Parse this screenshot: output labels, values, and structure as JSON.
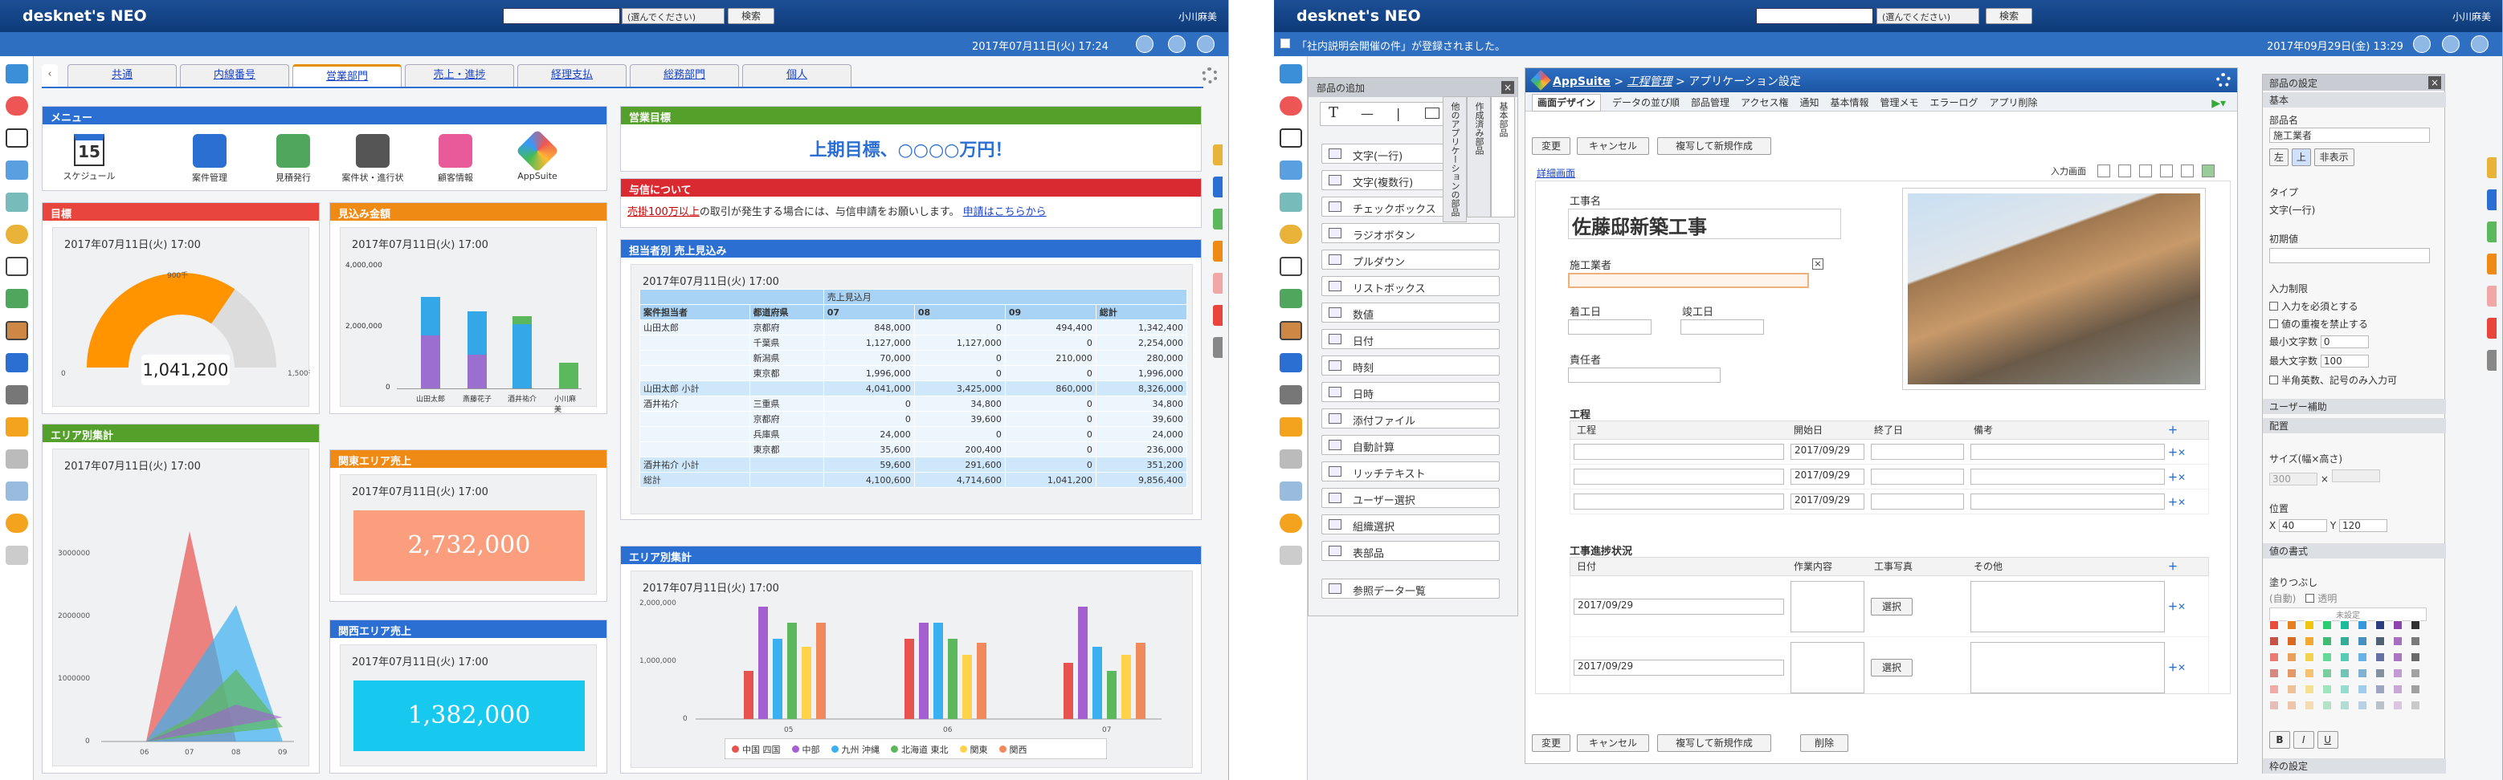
{
  "common": {
    "logo": "desknet's NEO",
    "select": "(選んでください)",
    "search": "検索",
    "user": "小川麻美"
  },
  "w1": {
    "date": "2017年07月11日(火) 17:24",
    "tabs": [
      "共通",
      "内線番号",
      "営業部門",
      "売上・進捗",
      "経理支払",
      "総務部門",
      "個人"
    ],
    "menu": {
      "title": "メニュー",
      "items": [
        "スケジュール",
        "案件管理",
        "見積発行",
        "案件状・進行状",
        "顧客情報",
        "AppSuite"
      ],
      "cal_day": "15"
    },
    "goal": {
      "title": "目標",
      "ts": "2017年07月11日(火) 17:00",
      "value": "1,041,200",
      "min": "0",
      "mid": "900千",
      "max": "1,500千",
      "fraction": 0.69
    },
    "mikomi": {
      "title": "見込み金額",
      "ts": "2017年07月11日(火) 17:00",
      "ylabels": [
        "4,000,000",
        "2,000,000",
        "0"
      ],
      "names": [
        "山田太郎",
        "斎藤花子",
        "酒井祐介",
        "小川麻美"
      ]
    },
    "area": {
      "title": "エリア別集計",
      "ts": "2017年07月11日(火) 17:00",
      "ylabels": [
        "3000000",
        "2000000",
        "1000000",
        "0"
      ],
      "x": [
        "06",
        "07",
        "08",
        "09"
      ]
    },
    "kanto": {
      "title": "関東エリア売上",
      "ts": "2017年07月11日(火) 17:00",
      "value": "2,732,000",
      "color": "#fb9e7d"
    },
    "kansai": {
      "title": "関西エリア売上",
      "ts": "2017年07月11日(火) 17:00",
      "value": "1,382,000",
      "color": "#17c8ef"
    },
    "target": {
      "title": "営業目標",
      "text": "上期目標、○○○○万円！"
    },
    "yoshin": {
      "title": "与信について",
      "red": "売掛100万以上",
      "text": "の取引が発生する場合には、与信申請をお願いします。",
      "link": "申請はこちらから"
    },
    "table": {
      "title": "担当者別 売上見込み",
      "ts": "2017年07月11日(火) 17:00",
      "head": [
        "案件担当者",
        "都道府県",
        "07",
        "08",
        "09",
        "総計"
      ],
      "super": "売上見込月",
      "rows": [
        [
          "山田太郎",
          "京都府",
          "848,000",
          "0",
          "494,400",
          "1,342,400"
        ],
        [
          "",
          "千葉県",
          "1,127,000",
          "1,127,000",
          "0",
          "2,254,000"
        ],
        [
          "",
          "新潟県",
          "70,000",
          "0",
          "210,000",
          "280,000"
        ],
        [
          "",
          "東京都",
          "1,996,000",
          "0",
          "0",
          "1,996,000"
        ],
        [
          "山田太郎 小計",
          "",
          "4,041,000",
          "3,425,000",
          "860,000",
          "8,326,000"
        ],
        [
          "酒井祐介",
          "三重県",
          "0",
          "34,800",
          "0",
          "34,800"
        ],
        [
          "",
          "京都府",
          "0",
          "39,600",
          "0",
          "39,600"
        ],
        [
          "",
          "兵庫県",
          "24,000",
          "0",
          "0",
          "24,000"
        ],
        [
          "",
          "東京都",
          "35,600",
          "200,400",
          "0",
          "236,000"
        ],
        [
          "酒井祐介 小計",
          "",
          "59,600",
          "291,600",
          "0",
          "351,200"
        ],
        [
          "総計",
          "",
          "4,100,600",
          "4,714,600",
          "1,041,200",
          "9,856,400"
        ]
      ]
    },
    "area2": {
      "title": "エリア別集計",
      "ts": "2017年07月11日(火) 17:00",
      "ylabels": [
        "2,000,000",
        "1,000,000",
        "0"
      ],
      "x": [
        "05",
        "06",
        "07"
      ],
      "legend": [
        "中国 四国",
        "中部",
        "九州 沖縄",
        "北海道 東北",
        "関東",
        "関西"
      ],
      "colors": [
        "#e8534f",
        "#a45fd0",
        "#3bb0f0",
        "#5cb85c",
        "#ffd24a",
        "#f08a5d"
      ]
    }
  },
  "w2": {
    "notice": "「社内説明会開催の件」が登録されました。",
    "date": "2017年09月29日(金) 13:29",
    "palette": {
      "title": "部品の追加",
      "items": [
        "文字(一行)",
        "文字(複数行)",
        "チェックボックス",
        "ラジオボタン",
        "プルダウン",
        "リストボックス",
        "数値",
        "日付",
        "時刻",
        "日時",
        "添付ファイル",
        "自動計算",
        "リッチテキスト",
        "ユーザー選択",
        "組織選択",
        "表部品"
      ],
      "ref": "参照データ一覧",
      "vtabs": [
        "基本部品",
        "作成済み部品",
        "他のアプリケーションの部品"
      ]
    },
    "crumb": {
      "app": "AppSuite",
      "mid": "工程管理",
      "last": "アプリケーション設定"
    },
    "menu": [
      "画面デザイン",
      "データの並び順",
      "部品管理",
      "アクセス権",
      "通知",
      "基本情報",
      "管理メモ",
      "エラーログ",
      "アプリ削除"
    ],
    "buttons": {
      "change": "変更",
      "cancel": "キャンセル",
      "copy": "複写して新規作成",
      "delete": "削除"
    },
    "detail": "詳細画面",
    "inscreen": "入力画面",
    "form": {
      "koji": "工事名",
      "kojiname": "佐藤邸新築工事",
      "sekou": "施工業者",
      "start": "着工日",
      "end": "竣工日",
      "resp": "責任者",
      "proc": "工程",
      "proccols": [
        "工程",
        "開始日",
        "終了日",
        "備考"
      ],
      "date": "2017/09/29",
      "status": "工事進捗状況",
      "statcols": [
        "日付",
        "作業内容",
        "工事写真",
        "その他"
      ],
      "select": "選択"
    },
    "props": {
      "title": "部品の設定",
      "sec1": "基本",
      "name_lbl": "部品名",
      "name": "施工業者",
      "align": [
        "左",
        "上",
        "非表示"
      ],
      "type_lbl": "タイプ",
      "type": "文字(一行)",
      "init": "初期値",
      "limit": "入力制限",
      "c1": "入力を必須とする",
      "c2": "値の重複を禁止する",
      "min_lbl": "最小文字数",
      "min": "0",
      "max_lbl": "最大文字数",
      "max": "100",
      "c3": "半角英数、記号のみ入力可",
      "sec2": "ユーザー補助",
      "sec3": "配置",
      "size": "サイズ(幅×高さ)",
      "w": "300",
      "pos": "位置",
      "x": "40",
      "y": "120",
      "sec4": "値の書式",
      "fill": "塗りつぶし",
      "auto": "(自動)",
      "trans": "透明",
      "unset": "未設定",
      "sec5": "枠の設定"
    }
  }
}
